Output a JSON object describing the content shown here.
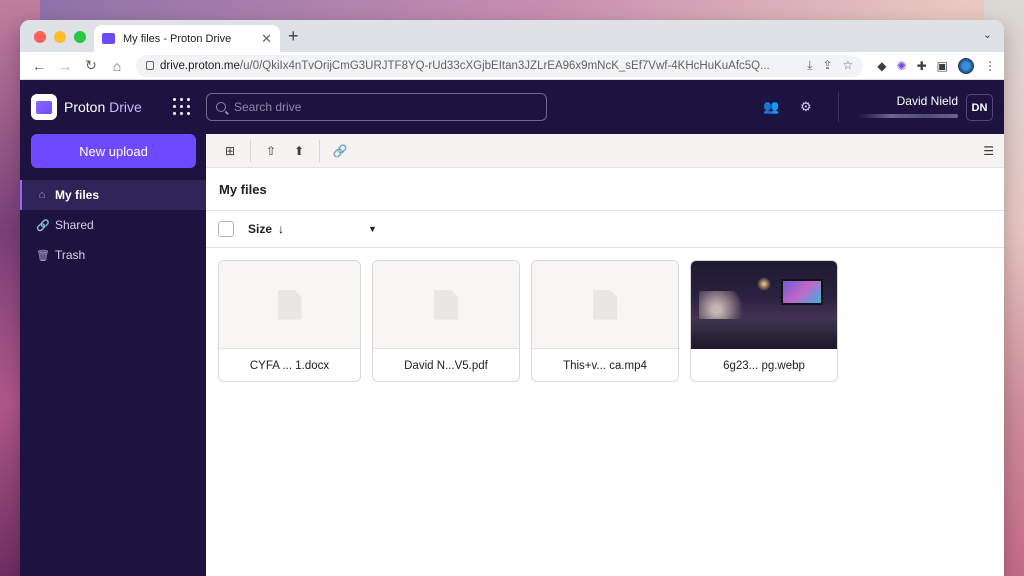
{
  "browser": {
    "tab_title": "My files - Proton Drive",
    "url_host": "drive.proton.me",
    "url_path": "/u/0/QkiIx4nTvOrijCmG3URJTF8YQ-rUd33cXGjbEItan3JZLrEA96x9mNcK_sEf7Vwf-4KHcHuKuAfc5Q..."
  },
  "app": {
    "logo_proton": "Proton",
    "logo_drive": "Drive",
    "search_placeholder": "Search drive",
    "user_name": "David Nield",
    "user_initials": "DN"
  },
  "sidebar": {
    "upload_label": "New upload",
    "items": [
      {
        "label": "My files",
        "icon": "drive-icon",
        "active": true
      },
      {
        "label": "Shared",
        "icon": "link-icon",
        "active": false
      },
      {
        "label": "Trash",
        "icon": "trash-icon",
        "active": false
      }
    ]
  },
  "main": {
    "title": "My files",
    "sort_label": "Size",
    "files": [
      {
        "name": "CYFA ... 1.docx",
        "type": "document"
      },
      {
        "name": "David N...V5.pdf",
        "type": "document"
      },
      {
        "name": "This+v... ca.mp4",
        "type": "document"
      },
      {
        "name": "6g23... pg.webp",
        "type": "image"
      }
    ]
  },
  "colors": {
    "accent": "#6d4aff",
    "sidebar_bg": "#1c1340"
  }
}
